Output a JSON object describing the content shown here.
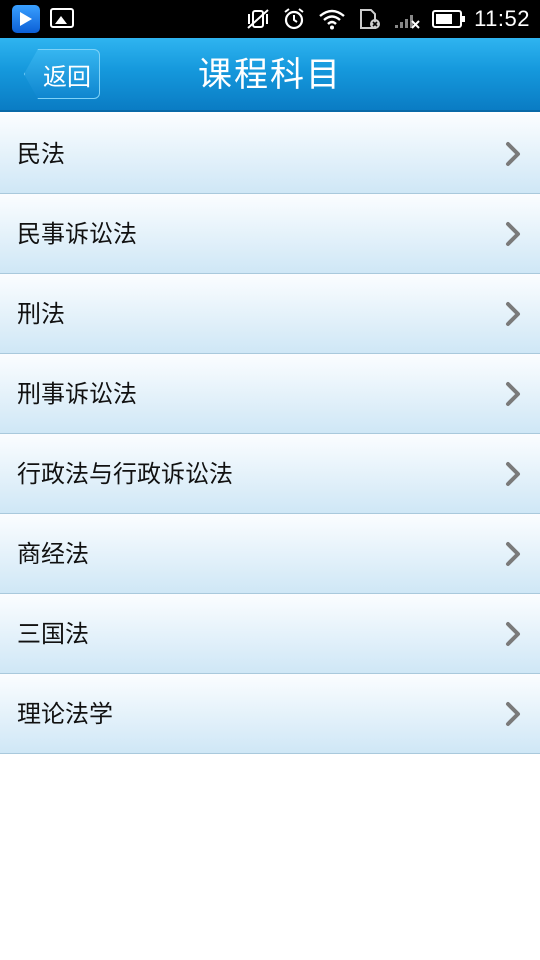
{
  "status_bar": {
    "time": "11:52",
    "icons": [
      "video-player-app-icon",
      "gallery-icon",
      "vibrate-off-icon",
      "alarm-icon",
      "wifi-icon",
      "sim-card-icon",
      "signal-icon",
      "battery-icon"
    ]
  },
  "header": {
    "back_label": "返回",
    "title": "课程科目"
  },
  "list": {
    "items": [
      {
        "label": "民法"
      },
      {
        "label": "民事诉讼法"
      },
      {
        "label": "刑法"
      },
      {
        "label": "刑事诉讼法"
      },
      {
        "label": "行政法与行政诉讼法"
      },
      {
        "label": "商经法"
      },
      {
        "label": "三国法"
      },
      {
        "label": "理论法学"
      }
    ]
  },
  "colors": {
    "header_blue": "#1598dc",
    "row_top": "#fbfdff",
    "row_bottom": "#cfe7f6",
    "chevron": "#7a7a7a"
  }
}
